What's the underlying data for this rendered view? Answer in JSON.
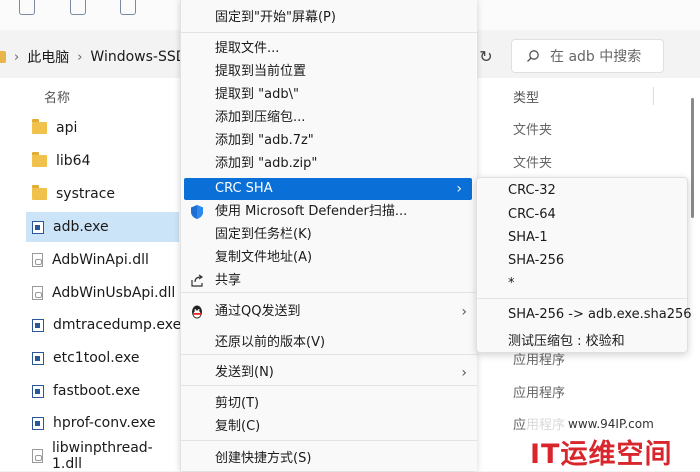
{
  "explorer": {
    "breadcrumb": [
      "此电脑",
      "Windows-SSD"
    ],
    "search_placeholder": "在 adb 中搜索",
    "columns": {
      "name": "名称",
      "type": "类型"
    },
    "files": [
      {
        "name": "api",
        "kind": "folder",
        "type": "文件夹"
      },
      {
        "name": "lib64",
        "kind": "folder",
        "type": "文件夹"
      },
      {
        "name": "systrace",
        "kind": "folder",
        "type": ""
      },
      {
        "name": "adb.exe",
        "kind": "exe",
        "type": "",
        "selected": true
      },
      {
        "name": "AdbWinApi.dll",
        "kind": "dll",
        "type": ""
      },
      {
        "name": "AdbWinUsbApi.dll",
        "kind": "dll",
        "type": ""
      },
      {
        "name": "dmtracedump.exe",
        "kind": "exe",
        "type": "应用程序"
      },
      {
        "name": "etc1tool.exe",
        "kind": "exe",
        "type": "应用程序"
      },
      {
        "name": "fastboot.exe",
        "kind": "exe",
        "type": "应用程序"
      },
      {
        "name": "hprof-conv.exe",
        "kind": "exe",
        "type": "应用程序"
      },
      {
        "name": "libwinpthread-1.dll",
        "kind": "dll",
        "type": ""
      }
    ]
  },
  "context_menu": {
    "items": [
      {
        "label": "固定到\"开始\"屏幕(P)"
      },
      {
        "label": "提取文件..."
      },
      {
        "label": "提取到当前位置"
      },
      {
        "label": "提取到 \"adb\\\""
      },
      {
        "label": "添加到压缩包..."
      },
      {
        "label": "添加到 \"adb.7z\""
      },
      {
        "label": "添加到 \"adb.zip\""
      },
      {
        "label": "CRC SHA",
        "submenu": true,
        "highlighted": true
      },
      {
        "label": "使用 Microsoft Defender扫描...",
        "icon": "shield-icon"
      },
      {
        "label": "固定到任务栏(K)"
      },
      {
        "label": "复制文件地址(A)"
      },
      {
        "label": "共享",
        "icon": "share-icon"
      },
      {
        "label": "通过QQ发送到",
        "icon": "qq-icon",
        "submenu": true
      },
      {
        "label": "还原以前的版本(V)"
      },
      {
        "label": "发送到(N)",
        "submenu": true
      },
      {
        "label": "剪切(T)"
      },
      {
        "label": "复制(C)"
      },
      {
        "label": "创建快捷方式(S)"
      }
    ]
  },
  "crc_submenu": {
    "items": [
      "CRC-32",
      "CRC-64",
      "SHA-1",
      "SHA-256",
      "*",
      "SHA-256 -> adb.exe.sha256",
      "测试压缩包 : 校验和"
    ]
  },
  "watermark": {
    "url": "www.94IP.com",
    "brand": "IT运维空间"
  },
  "colors": {
    "highlight": "#0a6fd6",
    "selection": "#cce4f7",
    "folder": "#f0c24b",
    "brand_red": "#d9262c"
  }
}
